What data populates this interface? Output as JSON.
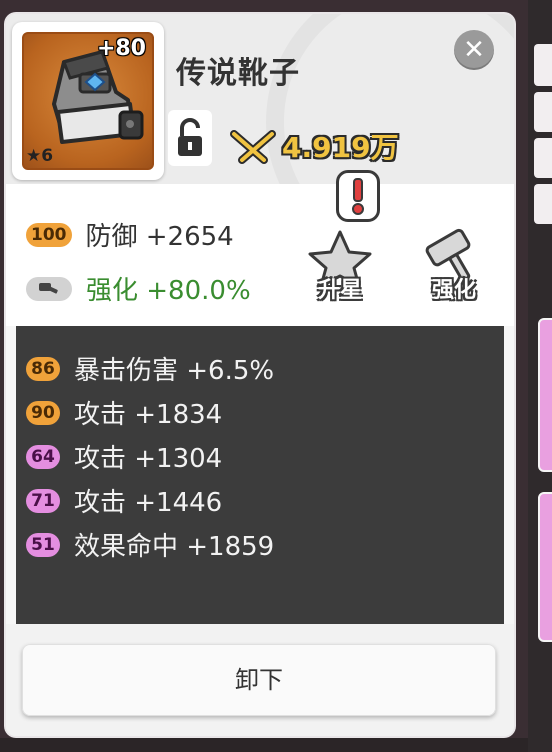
{
  "item": {
    "name": "传说靴子",
    "enhance_level": "+80",
    "star_count": "6",
    "star_symbol": "★",
    "power": "4.919万",
    "rarity_color": "#c4702a"
  },
  "main_stats": [
    {
      "badge": "100",
      "badge_color": "orange",
      "text": "防御 +2654"
    },
    {
      "badge_icon": "hammer-icon",
      "text": "强化 +80.0%",
      "color": "#3a8d30"
    }
  ],
  "actions": {
    "star_up_label": "升星",
    "enhance_label": "强化",
    "alert_symbol": "!"
  },
  "sub_stats": [
    {
      "badge": "86",
      "badge_color": "orange",
      "text": "暴击伤害 +6.5%"
    },
    {
      "badge": "90",
      "badge_color": "orange",
      "text": "攻击 +1834"
    },
    {
      "badge": "64",
      "badge_color": "pink",
      "text": "攻击 +1304"
    },
    {
      "badge": "71",
      "badge_color": "pink",
      "text": "攻击 +1446"
    },
    {
      "badge": "51",
      "badge_color": "pink",
      "text": "效果命中 +1859"
    }
  ],
  "footer": {
    "unequip_label": "卸下"
  },
  "colors": {
    "power_text": "#f0c341",
    "sub_panel": "#3c3c3c",
    "orange_badge": "#f0a23a",
    "pink_badge": "#e48ee0"
  }
}
